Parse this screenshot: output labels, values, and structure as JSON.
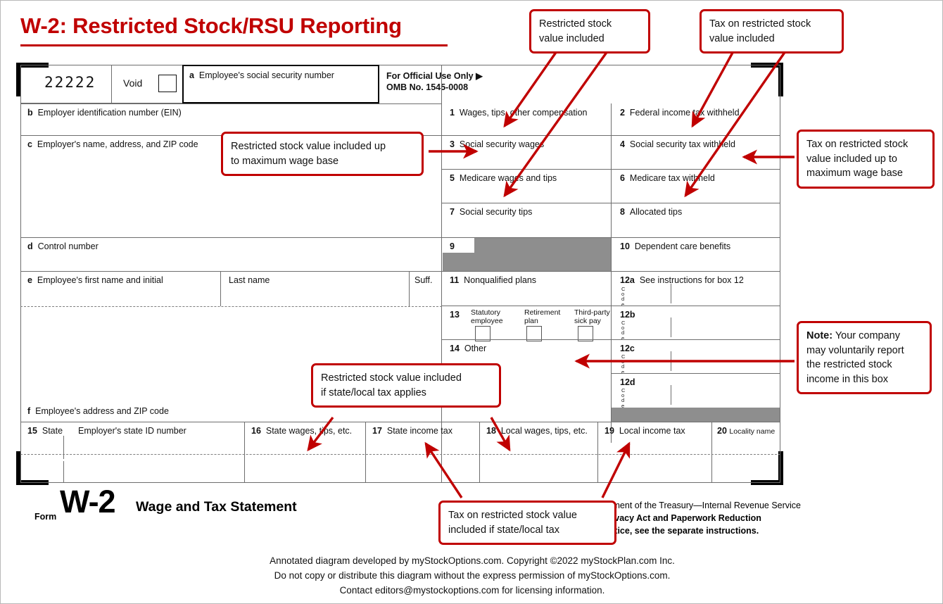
{
  "title": "W-2: Restricted Stock/RSU Reporting",
  "accent_color": "#c00000",
  "form": {
    "control_number": "22222",
    "void_label": "Void",
    "box_a": "Employee's social security number",
    "official_use": "For Official Use Only ▶",
    "omb": "OMB No. 1545-0008",
    "box_b": "Employer identification number (EIN)",
    "box_c": "Employer's name, address, and ZIP code",
    "box_d": "Control number",
    "box_e": "Employee's first name and initial",
    "box_e_last": "Last name",
    "box_e_suff": "Suff.",
    "box_f": "Employee's address and ZIP code",
    "box_1_num": "1",
    "box_1": "Wages, tips, other compensation",
    "box_2_num": "2",
    "box_2": "Federal income tax withheld",
    "box_3_num": "3",
    "box_3": "Social security wages",
    "box_4_num": "4",
    "box_4": "Social security tax withheld",
    "box_5_num": "5",
    "box_5": "Medicare wages and tips",
    "box_6_num": "6",
    "box_6": "Medicare tax withheld",
    "box_7_num": "7",
    "box_7": "Social security tips",
    "box_8_num": "8",
    "box_8": "Allocated tips",
    "box_9_num": "9",
    "box_10_num": "10",
    "box_10": "Dependent care benefits",
    "box_11_num": "11",
    "box_11": "Nonqualified plans",
    "box_12a_num": "12a",
    "box_12a": "See instructions for box 12",
    "box_12b_num": "12b",
    "box_12c_num": "12c",
    "box_12d_num": "12d",
    "code_label": "Code",
    "box_13_num": "13",
    "box_13_statutory": "Statutory\nemployee",
    "box_13_statutory_l1": "Statutory",
    "box_13_statutory_l2": "employee",
    "box_13_retirement_l1": "Retirement",
    "box_13_retirement_l2": "plan",
    "box_13_thirdparty_l1": "Third-party",
    "box_13_thirdparty_l2": "sick pay",
    "box_14_num": "14",
    "box_14": "Other",
    "box_15_num": "15",
    "box_15": "State",
    "box_15_emp": "Employer's state ID number",
    "box_16_num": "16",
    "box_16": "State wages, tips, etc.",
    "box_17_num": "17",
    "box_17": "State income tax",
    "box_18_num": "18",
    "box_18": "Local wages, tips, etc.",
    "box_19_num": "19",
    "box_19": "Local income tax",
    "box_20_num": "20",
    "box_20": "Locality name",
    "form_word": "Form",
    "form_number": "W-2",
    "form_title": "Wage and Tax Statement",
    "dept_line": "Department of the Treasury—Internal Revenue Service",
    "privacy_line_1": "For Privacy Act and Paperwork Reduction",
    "privacy_line_2": "Act Notice, see the separate instructions."
  },
  "annotations": {
    "restricted_stock_value_included": "Restricted stock\nvalue included",
    "rsvi_l1": "Restricted stock",
    "rsvi_l2": "value included",
    "tax_on_rsv_included_l1": "Tax on restricted stock",
    "tax_on_rsv_included_l2": "value included",
    "rsv_max_wage_base_l1": "Restricted stock value included up",
    "rsv_max_wage_base_l2": "to maximum wage base",
    "tax_rsv_max_wage_base_l1": "Tax on restricted stock",
    "tax_rsv_max_wage_base_l2": "value included up to",
    "tax_rsv_max_wage_base_l3": "maximum wage base",
    "note_bold": "Note:",
    "note_l1": " Your company",
    "note_l2": "may voluntarily report",
    "note_l3": "the restricted stock",
    "note_l4": "income in this box",
    "rsv_state_local_l1": "Restricted stock value included",
    "rsv_state_local_l2": "if state/local tax applies",
    "tax_rsv_state_local_l1": "Tax on restricted stock value",
    "tax_rsv_state_local_l2": "included if state/local tax"
  },
  "footer": {
    "line1": "Annotated diagram developed by myStockOptions.com. Copyright ©2022 myStockPlan.com Inc.",
    "line2": "Do not copy or distribute this diagram without the express permission of myStockOptions.com.",
    "line3": "Contact editors@mystockoptions.com for licensing information."
  }
}
